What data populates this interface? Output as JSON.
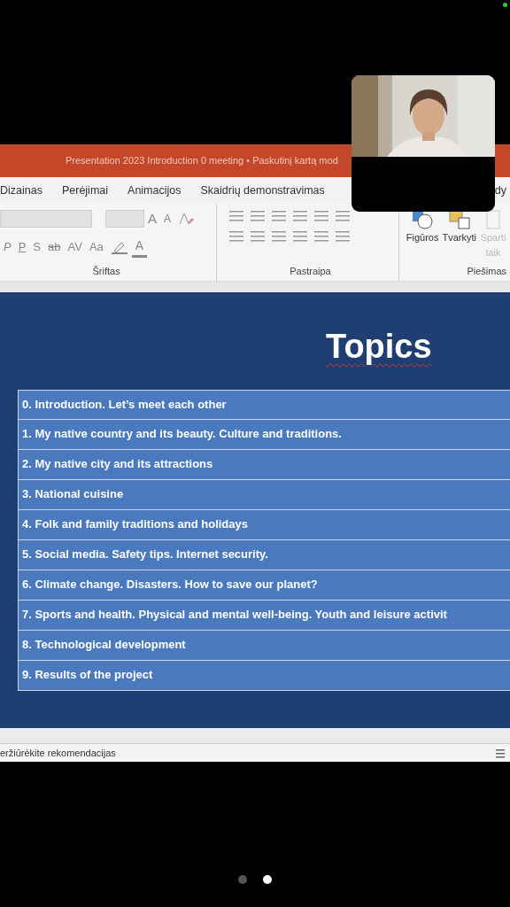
{
  "title_bar": {
    "text": "Presentation 2023 Introduction 0 meeting • Paskutinį kartą mod"
  },
  "ribbon_tabs": [
    {
      "label": "Dizainas"
    },
    {
      "label": "Perėjimai"
    },
    {
      "label": "Animacijos"
    },
    {
      "label": "Skaidrių demonstravimas"
    },
    {
      "label": "dy"
    }
  ],
  "ribbon": {
    "font_size_buttons": [
      "A",
      "A"
    ],
    "format_buttons": [
      "P",
      "P",
      "S",
      "ab",
      "AV",
      "Aa"
    ],
    "font_color_button": "A",
    "groups": [
      {
        "label": "Šriftas"
      },
      {
        "label": "Pastraipa"
      },
      {
        "label": "Piešimas"
      }
    ],
    "drawing_buttons": [
      {
        "label": "Figūros",
        "disabled": false
      },
      {
        "label": "Tvarkyti",
        "disabled": false
      },
      {
        "label": "Sparti\ntaik",
        "disabled": true
      }
    ]
  },
  "slide": {
    "title": "Topics",
    "rows": [
      {
        "text": "0. Introduction. Let’s meet each other"
      },
      {
        "text": "1. My native country and its beauty. Culture and traditions."
      },
      {
        "text": "2. My native city and its attractions"
      },
      {
        "text": "3. National cuisine"
      },
      {
        "text": "4. Folk and family traditions and holidays"
      },
      {
        "text": "5. Social media. Safety tips. Internet security."
      },
      {
        "text": "6. Climate change. Disasters. How to save our planet?"
      },
      {
        "text": "7. Sports and health. Physical and mental well-being. Youth and leisure activit"
      },
      {
        "text": "8. Technological development"
      },
      {
        "text": "9. Results of the project"
      }
    ]
  },
  "status_bar": {
    "text": "eržiūrėkite rekomendacijas"
  },
  "pages": [
    {
      "selected": false
    },
    {
      "selected": true
    }
  ]
}
